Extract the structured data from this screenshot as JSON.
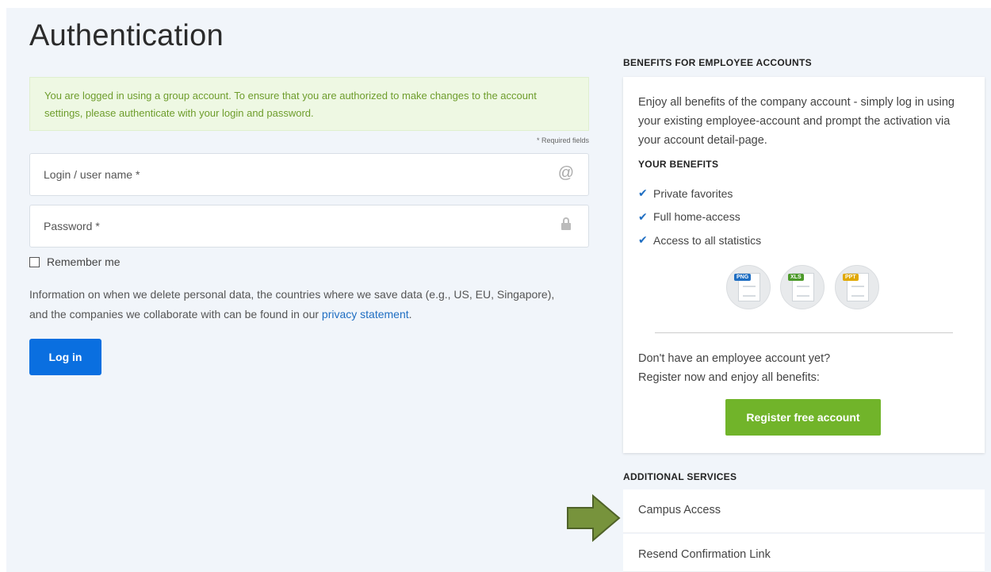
{
  "page": {
    "title": "Authentication"
  },
  "notice": {
    "text": "You are logged in using a group account. To ensure that you are authorized to make changes to the account settings, please authenticate with your login and password."
  },
  "form": {
    "required_note": "* Required fields",
    "login_label": "Login / user name *",
    "login_icon": "at-icon",
    "password_label": "Password *",
    "password_icon": "lock-icon",
    "remember_label": "Remember me",
    "remember_checked": false,
    "info_text": "Information on when we delete personal data, the countries where we save data (e.g., US, EU, Singapore), and the companies we collaborate with can be found in our ",
    "privacy_link": "privacy statement",
    "info_end": ".",
    "login_button": "Log in"
  },
  "benefits": {
    "heading": "BENEFITS FOR EMPLOYEE ACCOUNTS",
    "intro": "Enjoy all benefits of the company account - simply log in using your existing employee-account and prompt the activation via your account detail-page.",
    "sub_heading": "YOUR BENEFITS",
    "items": [
      "Private favorites",
      "Full home-access",
      "Access to all statistics"
    ],
    "file_icons": [
      "PNG",
      "XLS",
      "PPT"
    ],
    "register_line1": "Don't have an employee account yet?",
    "register_line2": "Register now and enjoy all benefits:",
    "register_button": "Register free account"
  },
  "additional": {
    "heading": "ADDITIONAL SERVICES",
    "items": [
      "Campus Access",
      "Resend Confirmation Link"
    ]
  },
  "colors": {
    "primary": "#0a6fe0",
    "register_green": "#71b42a",
    "notice_text": "#6e9d2c",
    "arrow_fill": "#77933c"
  }
}
